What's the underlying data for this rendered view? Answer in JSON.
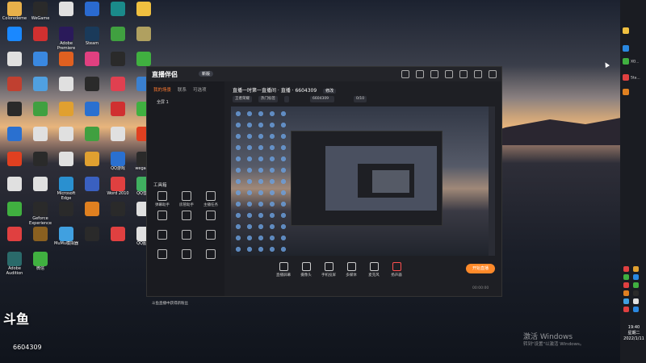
{
  "desktop": {
    "icons": [
      {
        "label": "Coloredeme",
        "color": "#e8b04a"
      },
      {
        "label": "WeGame",
        "color": "#2a2a2a"
      },
      {
        "label": "",
        "color": "#e0e0e0"
      },
      {
        "label": "",
        "color": "#2a6ad0"
      },
      {
        "label": "",
        "color": "#1a8a8a"
      },
      {
        "label": "",
        "color": "#f0c040"
      },
      {
        "label": "",
        "color": "#1a88ff"
      },
      {
        "label": "",
        "color": "#d03030"
      },
      {
        "label": "Adobe Premiere",
        "color": "#2a1a5a"
      },
      {
        "label": "Steam",
        "color": "#1a3a5a"
      },
      {
        "label": "",
        "color": "#40a040"
      },
      {
        "label": "",
        "color": "#b0a060"
      },
      {
        "label": "",
        "color": "#e0e0e0"
      },
      {
        "label": "",
        "color": "#3a88e0"
      },
      {
        "label": "",
        "color": "#e06020"
      },
      {
        "label": "",
        "color": "#e04080"
      },
      {
        "label": "",
        "color": "#2a2a2a"
      },
      {
        "label": "",
        "color": "#40b040"
      },
      {
        "label": "",
        "color": "#c04030"
      },
      {
        "label": "",
        "color": "#50a0e0"
      },
      {
        "label": "",
        "color": "#e0e0e0"
      },
      {
        "label": "",
        "color": "#2a2a2a"
      },
      {
        "label": "",
        "color": "#e04050"
      },
      {
        "label": "",
        "color": "#3a80d0"
      },
      {
        "label": "",
        "color": "#2a2a2a"
      },
      {
        "label": "",
        "color": "#40a040"
      },
      {
        "label": "",
        "color": "#e0a030"
      },
      {
        "label": "",
        "color": "#2a70d0"
      },
      {
        "label": "",
        "color": "#d03030"
      },
      {
        "label": "",
        "color": "#40b040"
      },
      {
        "label": "",
        "color": "#2a70d0"
      },
      {
        "label": "",
        "color": "#e0e0e0"
      },
      {
        "label": "",
        "color": "#e0e0e0"
      },
      {
        "label": "",
        "color": "#40a040"
      },
      {
        "label": "",
        "color": "#e0e0e0"
      },
      {
        "label": "",
        "color": "#e04020"
      },
      {
        "label": "",
        "color": "#e04020"
      },
      {
        "label": "",
        "color": "#2a2a2a"
      },
      {
        "label": "",
        "color": "#e0e0e0"
      },
      {
        "label": "",
        "color": "#e0a030"
      },
      {
        "label": "QQ游戏",
        "color": "#2a70d0"
      },
      {
        "label": "wegame",
        "color": "#2a2a2a"
      },
      {
        "label": "",
        "color": "#e0e0e0"
      },
      {
        "label": "",
        "color": "#e0e0e0"
      },
      {
        "label": "Microsoft Edge",
        "color": "#2a90d0"
      },
      {
        "label": "",
        "color": "#3a60c0"
      },
      {
        "label": "Word 2010",
        "color": "#e04040"
      },
      {
        "label": "QQ音乐",
        "color": "#40b060"
      },
      {
        "label": "",
        "color": "#40b040"
      },
      {
        "label": "Geforce Experience",
        "color": "#2a2a2a"
      },
      {
        "label": "",
        "color": "#2a2a2a"
      },
      {
        "label": "",
        "color": "#e08020"
      },
      {
        "label": "",
        "color": "#2a2a2a"
      },
      {
        "label": "",
        "color": "#e0e0e0"
      },
      {
        "label": "",
        "color": "#e04040"
      },
      {
        "label": "",
        "color": "#8a6020"
      },
      {
        "label": "MuMu模拟器",
        "color": "#40a0e0"
      },
      {
        "label": "",
        "color": "#2a2a2a"
      },
      {
        "label": "",
        "color": "#e04040"
      },
      {
        "label": "QQ图片",
        "color": "#e0e0e0"
      },
      {
        "label": "Adobe Audition",
        "color": "#2a6a6a"
      },
      {
        "label": "微信",
        "color": "#40b040"
      }
    ]
  },
  "app": {
    "title_logo": "直播伴侣",
    "version_badge": "新版",
    "left_tabs": [
      "我的场景",
      "联系",
      "可选项"
    ],
    "scene_item": "全屏 1",
    "tools_title": "工具箱",
    "tools": [
      "弹幕助手",
      "房管助手",
      "主播任务",
      "",
      "",
      "",
      "",
      "",
      "",
      "",
      "",
      ""
    ],
    "stream_title": "直播一时第一直播间 · 直播 · 6604309",
    "stream_title_btn": "修改",
    "tags": [
      "王者荣耀",
      "热门标签",
      "",
      "6604309",
      "",
      "0/10"
    ],
    "controls": [
      "直播屏幕",
      "摄像头",
      "手机投屏",
      "多媒体",
      "麦克风",
      "扬声器"
    ],
    "start_button": "开始直播",
    "status_items": [
      "",
      "",
      "",
      "",
      "",
      "",
      "",
      "",
      "",
      "00:00:00"
    ],
    "alert_text": "斗鱼直播中获得新粉丝"
  },
  "taskbar_right": {
    "items": [
      {
        "label": "",
        "color": "#f0c040"
      },
      {
        "label": "",
        "color": "#2a88e0"
      },
      {
        "label": "XO...",
        "color": "#40b040"
      },
      {
        "label": "Sta...",
        "color": "#e04040"
      },
      {
        "label": "",
        "color": "#e08020"
      }
    ]
  },
  "clock": {
    "time": "19:40",
    "day": "星期二",
    "date": "2022/1/11"
  },
  "activation": {
    "line1": "激活 Windows",
    "line2": "转到\"设置\"以激活 Windows。"
  },
  "watermark": {
    "logo": "斗鱼",
    "id": "6604309"
  }
}
